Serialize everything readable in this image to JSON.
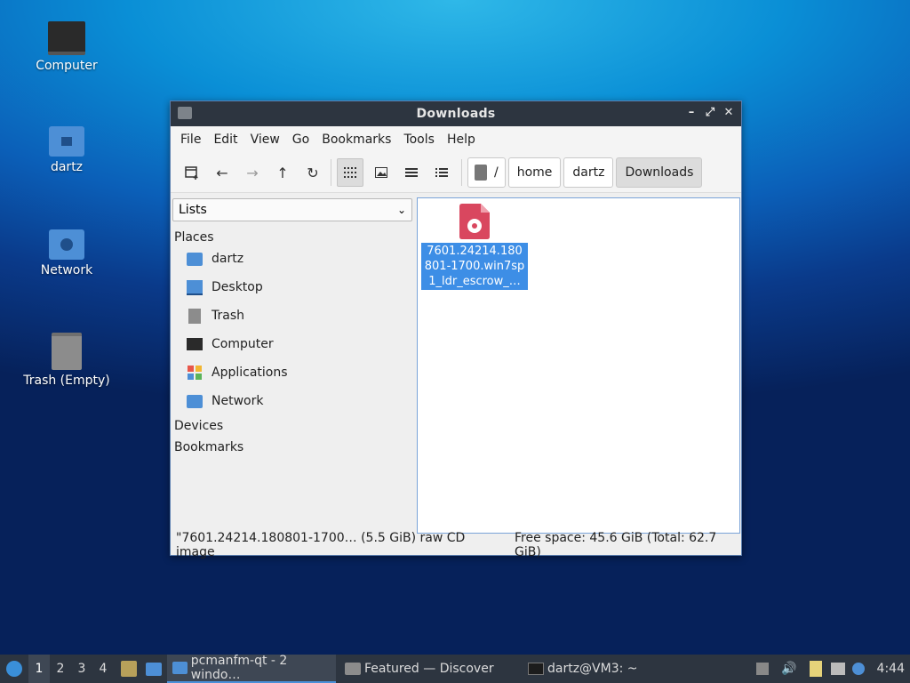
{
  "desktop": {
    "icons": [
      {
        "label": "Computer"
      },
      {
        "label": "dartz"
      },
      {
        "label": "Network"
      },
      {
        "label": "Trash (Empty)"
      }
    ]
  },
  "window": {
    "title": "Downloads",
    "controls": {
      "minimize": "–",
      "maximize": "⤢",
      "close": "✕"
    },
    "menu": [
      "File",
      "Edit",
      "View",
      "Go",
      "Bookmarks",
      "Tools",
      "Help"
    ],
    "breadcrumb": {
      "root": "/",
      "parts": [
        "home",
        "dartz",
        "Downloads"
      ]
    },
    "sidebar": {
      "view_mode": "Lists",
      "places_header": "Places",
      "places": [
        "dartz",
        "Desktop",
        "Trash",
        "Computer",
        "Applications",
        "Network"
      ],
      "devices_header": "Devices",
      "bookmarks_header": "Bookmarks"
    },
    "files": [
      {
        "label": "7601.24214.180801-1700.win7sp1_ldr_escrow_…",
        "lines": [
          "7601.24214.180",
          "801-1700.win7sp",
          "1_ldr_escrow_…"
        ]
      }
    ],
    "status": {
      "selection": "\"7601.24214.180801-1700… (5.5 GiB) raw CD image",
      "free_space": "Free space: 45.6 GiB (Total: 62.7 GiB)"
    }
  },
  "taskbar": {
    "workspaces": [
      "1",
      "2",
      "3",
      "4"
    ],
    "tasks": [
      "pcmanfm-qt - 2 windo…",
      "Featured — Discover",
      "dartz@VM3: ~"
    ],
    "clock": "4:44"
  },
  "colors": {
    "accent": "#3d8ee6",
    "titlebar": "#2d3540",
    "iso_icon": "#d9475f"
  }
}
